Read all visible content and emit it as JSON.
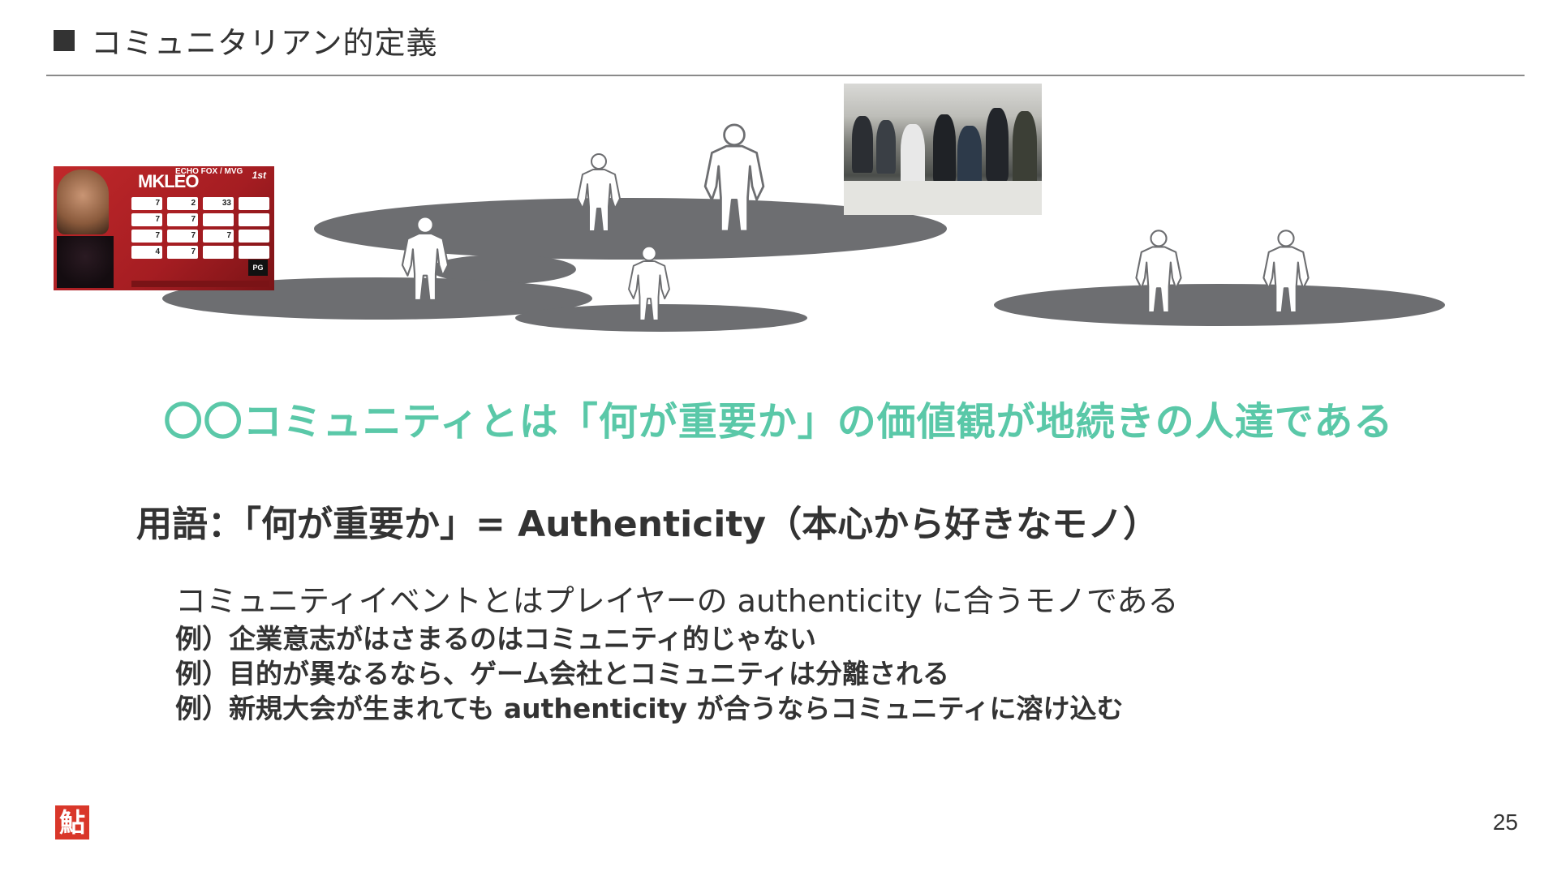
{
  "header": {
    "title": "コミュニタリアン的定義"
  },
  "photos": {
    "player_card": {
      "team": "ECHO FOX / MVG",
      "name": "MKLEO",
      "rank": "1st",
      "results": [
        "7",
        "2",
        "33",
        "",
        "7",
        "7",
        "",
        "",
        "7",
        "7",
        "7",
        "",
        "4",
        "7",
        "",
        ""
      ],
      "logo_text": "PG"
    }
  },
  "main_statement": "〇〇コミュニティとは「何が重要か」の価値観が地続きの人達である",
  "term": "用語：「何が重要か」= Authenticity（本心から好きなモノ）",
  "body": {
    "main": "コミュニティイベントとはプレイヤーの authenticity に合うモノである",
    "examples": [
      "例）企業意志がはさまるのはコミュニティ的じゃない",
      "例）目的が異なるなら、ゲーム会社とコミュニティは分離される",
      "例）新規大会が生まれても authenticity が合うならコミュニティに溶け込む"
    ]
  },
  "footer": {
    "logo_glyph": "鮎",
    "page_number": "25"
  },
  "colors": {
    "accent": "#5ac8a8",
    "text": "#333333",
    "ellipse": "#6d6e71"
  }
}
